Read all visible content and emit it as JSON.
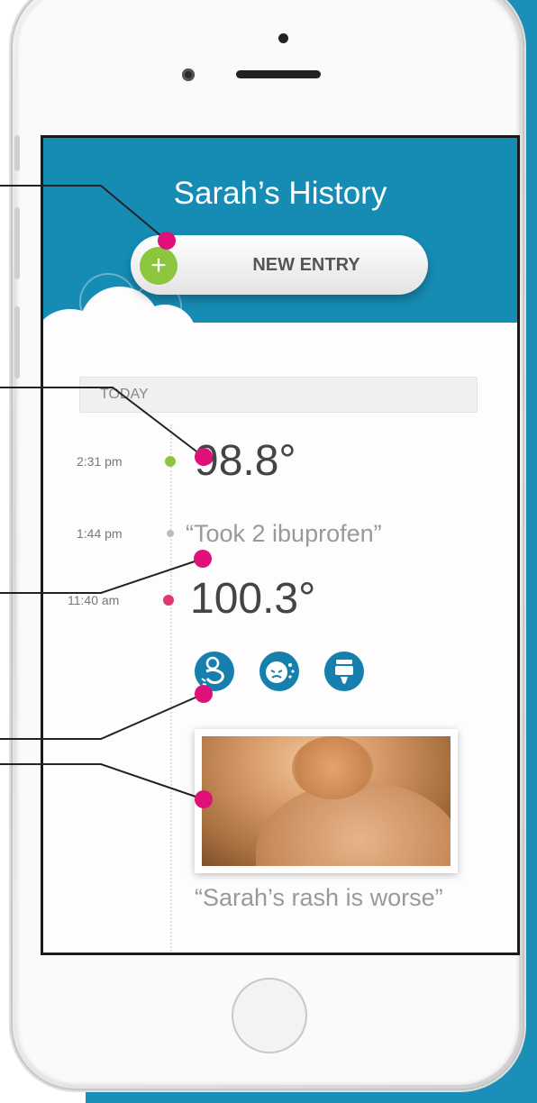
{
  "header": {
    "title": "Sarah’s History"
  },
  "new_entry": {
    "plus": "+",
    "label": "NEW ENTRY"
  },
  "section": {
    "label": "TODAY"
  },
  "entries": [
    {
      "time": "2:31 pm",
      "value": "98.8°",
      "dot_color": "#8cc63f"
    },
    {
      "time": "1:44 pm",
      "value": "“Took 2 ibuprofen”",
      "dot_color": "#bbbbbb"
    },
    {
      "time": "11:40 am",
      "value": "100.3°",
      "dot_color": "#e0396f"
    }
  ],
  "symptom_icons": [
    "stomach-ache-icon",
    "cough-icon",
    "vomit-icon"
  ],
  "photo_caption": "“Sarah’s rash is worse”",
  "colors": {
    "accent_blue": "#168bb4",
    "callout_pink": "#e0107a",
    "plus_green": "#8cc63f"
  }
}
